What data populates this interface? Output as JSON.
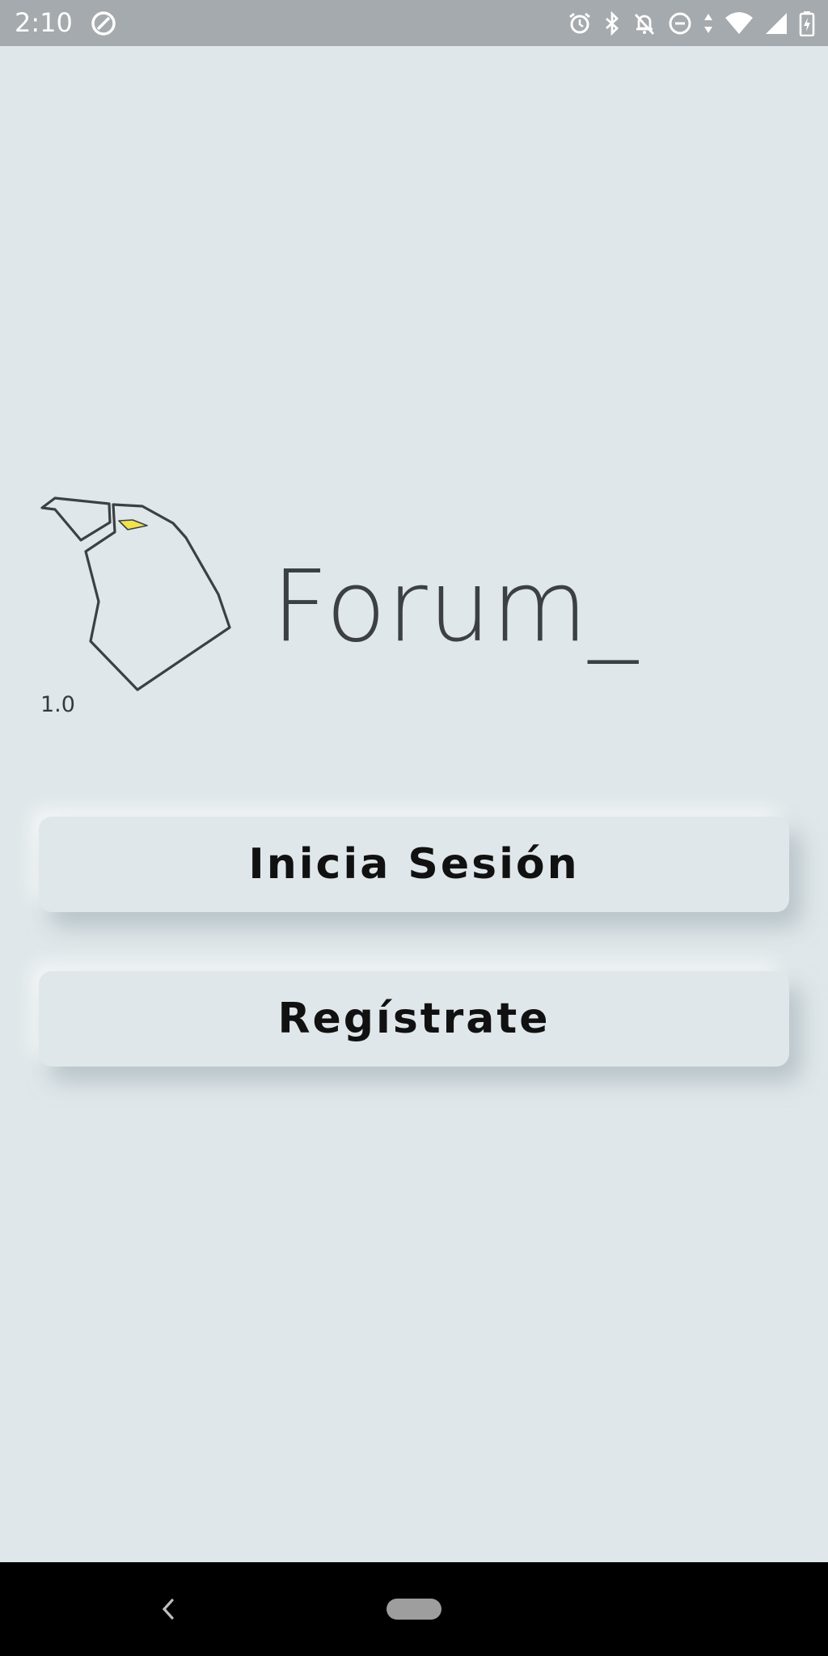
{
  "status_bar": {
    "time": "2:10",
    "left_icon": "data-saver-icon",
    "icons": [
      "alarm-icon",
      "bluetooth-icon",
      "notifications-off-icon",
      "do-not-disturb-icon",
      "wifi-icon",
      "cell-signal-icon",
      "battery-charging-icon"
    ]
  },
  "logo": {
    "icon": "forum-map-logo-icon",
    "accent_color": "#f2e24f",
    "stroke_color": "#3c4043",
    "version": "1.0",
    "brand": "Forum_"
  },
  "buttons": {
    "login_label": "Inicia Sesión",
    "register_label": "Regístrate"
  },
  "nav_bar": {
    "back_icon": "back-chevron-icon",
    "home_icon": "home-pill-icon"
  },
  "colors": {
    "background": "#dfe7ea",
    "status_bar": "#a4aaad",
    "nav_bar": "#000000",
    "text": "#111111"
  }
}
